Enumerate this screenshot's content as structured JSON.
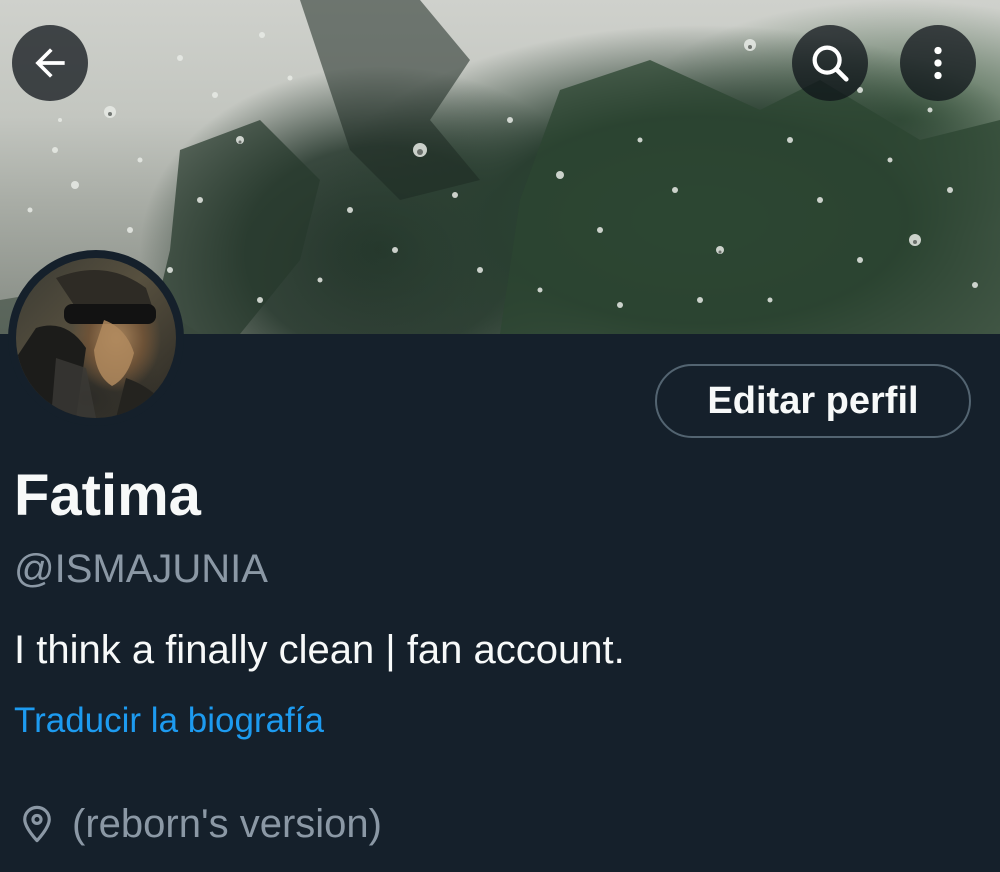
{
  "header": {
    "back_icon": "arrow-left-icon",
    "search_icon": "search-icon",
    "more_icon": "more-vertical-icon"
  },
  "profile": {
    "name": "Fatima",
    "handle": "@ISMAJUNIA",
    "bio": "I think a finally clean | fan account.",
    "translate_link": "Traducir la biografía",
    "location": "(reborn's version)",
    "location_icon": "location-pin-icon",
    "edit_button_label": "Editar perfil"
  },
  "colors": {
    "background": "#15202b",
    "primary_text": "#f7f9f9",
    "secondary_text": "#8b98a5",
    "link": "#1d9bf0",
    "button_border": "#536471"
  }
}
